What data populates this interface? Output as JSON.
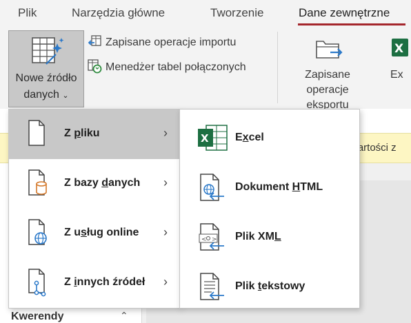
{
  "tabs": [
    {
      "label": "Plik"
    },
    {
      "label": "Narzędzia główne"
    },
    {
      "label": "Tworzenie"
    },
    {
      "label": "Dane zewnętrzne"
    }
  ],
  "ribbon": {
    "new_source": {
      "line1": "Nowe źródło",
      "line2": "danych",
      "icon": "table-sparkle-icon"
    },
    "saved_imports": "Zapisane operacje importu",
    "linked_table_manager": "Menedżer tabel połączonych",
    "saved_exports": {
      "line1": "Zapisane",
      "line2": "operacje eksportu"
    },
    "excel_export_partial": "Ex"
  },
  "notification": {
    "text": "wartości z"
  },
  "nav_pane": {
    "title": "Kwerendy"
  },
  "menu_primary": [
    {
      "pre": "Z ",
      "key": "p",
      "post": "liku",
      "icon": "file-icon",
      "selected": true
    },
    {
      "pre": "Z bazy ",
      "key": "d",
      "post": "anych",
      "icon": "database-file-icon",
      "selected": false
    },
    {
      "pre": "Z u",
      "key": "s",
      "post": "ług online",
      "icon": "globe-file-icon",
      "selected": false
    },
    {
      "pre": "Z ",
      "key": "i",
      "post": "nnych źródeł",
      "icon": "network-file-icon",
      "selected": false
    }
  ],
  "menu_secondary": [
    {
      "pre": "E",
      "key": "x",
      "post": "cel",
      "icon": "excel-icon"
    },
    {
      "pre": "Dokument ",
      "key": "H",
      "post": "TML",
      "icon": "html-document-icon"
    },
    {
      "pre": "Plik XM",
      "key": "L",
      "post": "",
      "icon": "xml-document-icon"
    },
    {
      "pre": "Plik ",
      "key": "t",
      "post": "ekstowy",
      "icon": "text-document-icon"
    }
  ],
  "colors": {
    "accent": "#a4262c",
    "excel_green": "#1d6f42",
    "selection": "#c8c8c8",
    "arrow_blue": "#2b79c9"
  }
}
